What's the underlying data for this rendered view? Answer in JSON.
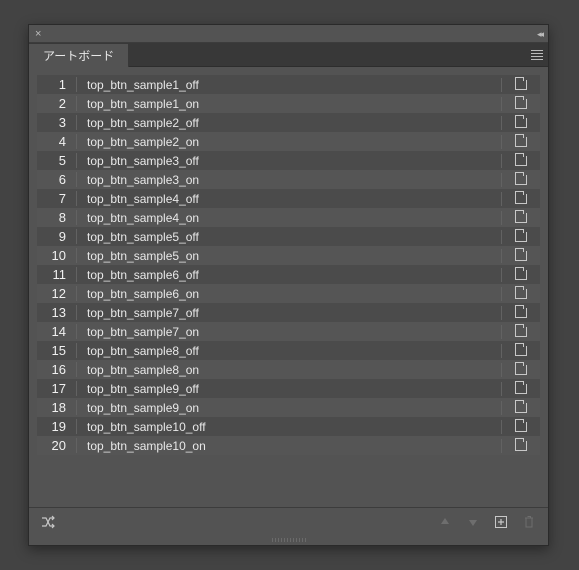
{
  "panel": {
    "tab_title": "アートボード"
  },
  "artboards": [
    {
      "num": "1",
      "name": "top_btn_sample1_off"
    },
    {
      "num": "2",
      "name": "top_btn_sample1_on"
    },
    {
      "num": "3",
      "name": "top_btn_sample2_off"
    },
    {
      "num": "4",
      "name": "top_btn_sample2_on"
    },
    {
      "num": "5",
      "name": "top_btn_sample3_off"
    },
    {
      "num": "6",
      "name": "top_btn_sample3_on"
    },
    {
      "num": "7",
      "name": "top_btn_sample4_off"
    },
    {
      "num": "8",
      "name": "top_btn_sample4_on"
    },
    {
      "num": "9",
      "name": "top_btn_sample5_off"
    },
    {
      "num": "10",
      "name": "top_btn_sample5_on"
    },
    {
      "num": "11",
      "name": "top_btn_sample6_off"
    },
    {
      "num": "12",
      "name": "top_btn_sample6_on"
    },
    {
      "num": "13",
      "name": "top_btn_sample7_off"
    },
    {
      "num": "14",
      "name": "top_btn_sample7_on"
    },
    {
      "num": "15",
      "name": "top_btn_sample8_off"
    },
    {
      "num": "16",
      "name": "top_btn_sample8_on"
    },
    {
      "num": "17",
      "name": "top_btn_sample9_off"
    },
    {
      "num": "18",
      "name": "top_btn_sample9_on"
    },
    {
      "num": "19",
      "name": "top_btn_sample10_off"
    },
    {
      "num": "20",
      "name": "top_btn_sample10_on"
    }
  ]
}
